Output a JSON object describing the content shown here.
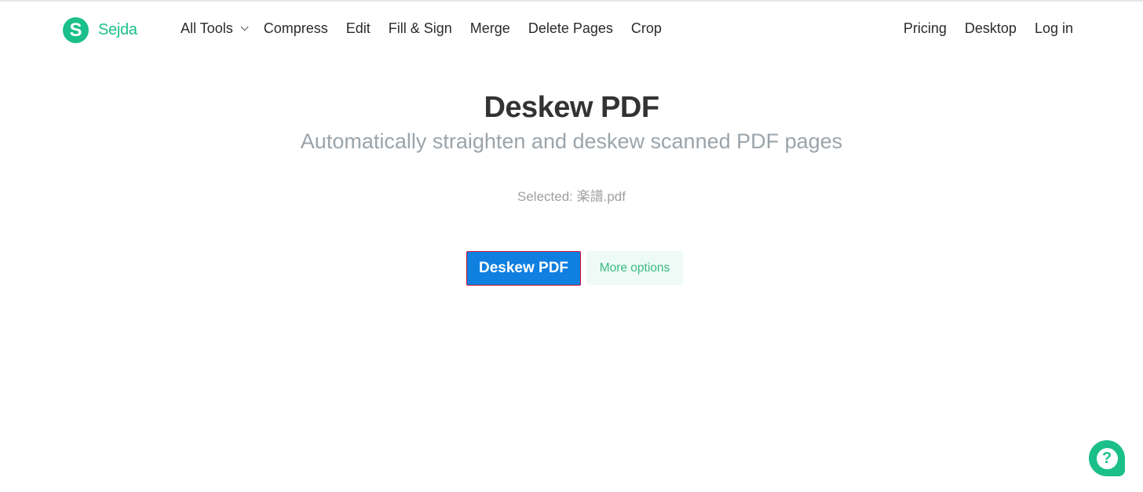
{
  "brand": {
    "logo_letter": "S",
    "name": "Sejda",
    "accent_color": "#1bbf8a"
  },
  "nav": {
    "left": [
      {
        "label": "All Tools",
        "has_dropdown": true
      },
      {
        "label": "Compress"
      },
      {
        "label": "Edit"
      },
      {
        "label": "Fill & Sign"
      },
      {
        "label": "Merge"
      },
      {
        "label": "Delete Pages"
      },
      {
        "label": "Crop"
      }
    ],
    "right": [
      {
        "label": "Pricing"
      },
      {
        "label": "Desktop"
      },
      {
        "label": "Log in"
      }
    ]
  },
  "hero": {
    "title": "Deskew PDF",
    "subtitle": "Automatically straighten and deskew scanned PDF pages",
    "selected_label": "Selected: 楽譜.pdf"
  },
  "actions": {
    "primary_label": "Deskew PDF",
    "secondary_label": "More options",
    "primary_color": "#0f7fe0"
  },
  "help": {
    "icon": "question-mark-icon",
    "glyph": "?"
  }
}
